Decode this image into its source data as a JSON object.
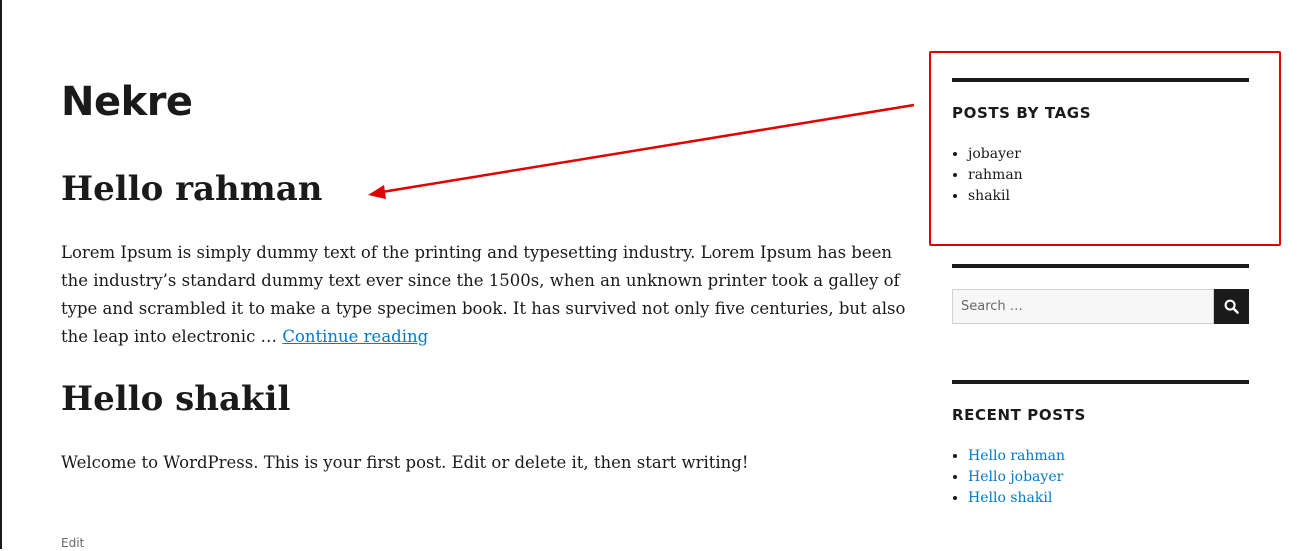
{
  "site": {
    "title": "Nekre"
  },
  "posts": [
    {
      "title": "Hello rahman",
      "excerpt": "Lorem Ipsum is simply dummy text of the printing and typesetting industry. Lorem Ipsum has been the industry’s standard dummy text ever since the 1500s, when an unknown printer took a galley of type and scrambled it to make a type specimen book. It has survived not only five centuries, but also the leap into electronic … ",
      "continue_label": "Continue reading"
    },
    {
      "title": "Hello shakil",
      "content": "Welcome to WordPress. This is your first post. Edit or delete it, then start writing!",
      "edit_label": "Edit"
    }
  ],
  "sidebar": {
    "tags_widget": {
      "title": "POSTS BY TAGS",
      "items": [
        "jobayer",
        "rahman",
        "shakil"
      ]
    },
    "search": {
      "placeholder": "Search …",
      "button_icon": "search-icon"
    },
    "recent_posts": {
      "title": "RECENT POSTS",
      "items": [
        "Hello rahman",
        "Hello jobayer",
        "Hello shakil"
      ]
    }
  },
  "colors": {
    "text": "#1a1a1a",
    "link": "#007acc",
    "annotation": "#e00000",
    "muted": "#686868"
  }
}
